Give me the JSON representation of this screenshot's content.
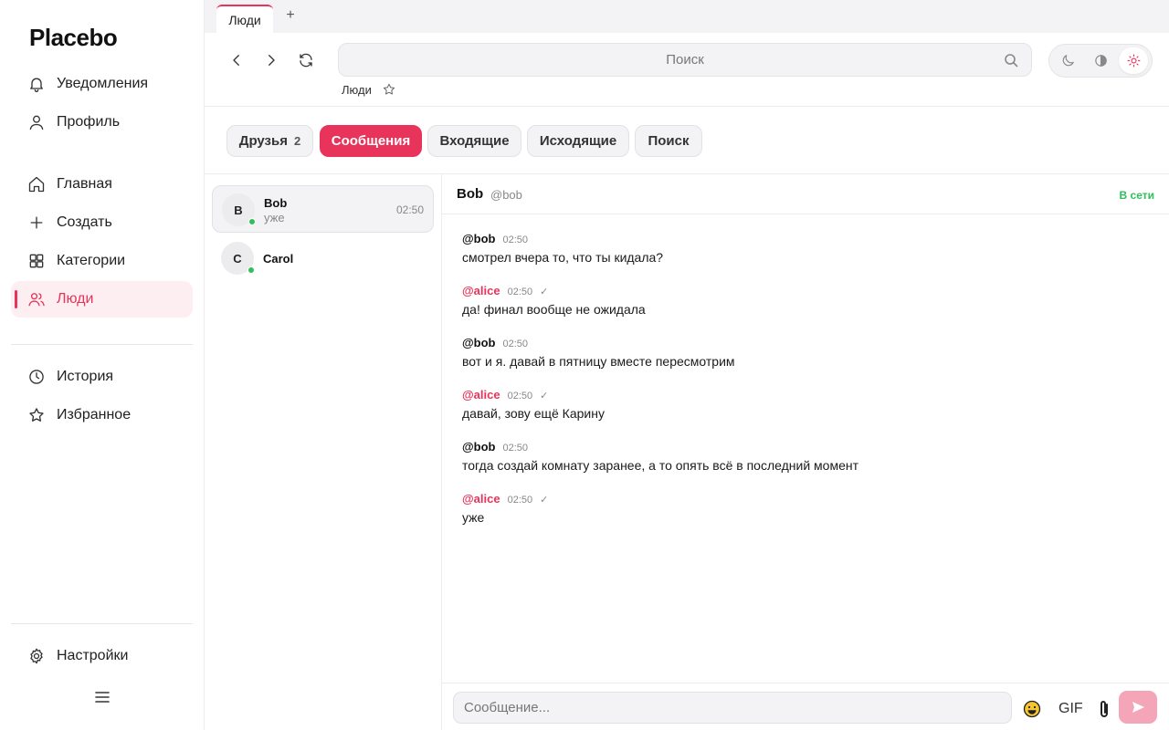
{
  "app": {
    "name": "Placebo"
  },
  "sidebar": {
    "items": [
      {
        "label": "Уведомления",
        "icon": "bell-icon"
      },
      {
        "label": "Профиль",
        "icon": "user-icon"
      },
      {
        "label": "Главная",
        "icon": "home-icon"
      },
      {
        "label": "Создать",
        "icon": "plus-icon"
      },
      {
        "label": "Категории",
        "icon": "grid-icon"
      },
      {
        "label": "Люди",
        "icon": "users-icon",
        "active": true
      },
      {
        "label": "История",
        "icon": "clock-icon"
      },
      {
        "label": "Избранное",
        "icon": "star-icon"
      }
    ],
    "settings_label": "Настройки",
    "menu_icon": "hamburger-icon"
  },
  "tabs": [
    {
      "label": "Люди",
      "active": true
    }
  ],
  "tab_add_label": "+",
  "toolbar": {
    "search_placeholder": "Поиск",
    "breadcrumb": "Люди",
    "theme_options": [
      "dark",
      "contrast",
      "light"
    ],
    "theme_selected": "light"
  },
  "filters": [
    {
      "label": "Друзья",
      "count": "2"
    },
    {
      "label": "Сообщения",
      "active": true
    },
    {
      "label": "Входящие"
    },
    {
      "label": "Исходящие"
    },
    {
      "label": "Поиск"
    }
  ],
  "conversations": [
    {
      "initial": "B",
      "name": "Bob",
      "preview": "уже",
      "time": "02:50",
      "online": true,
      "active": true
    },
    {
      "initial": "C",
      "name": "Carol",
      "preview": "",
      "time": "",
      "online": true,
      "active": false
    }
  ],
  "chat": {
    "name": "Bob",
    "handle": "@bob",
    "status": "В сети",
    "messages": [
      {
        "author": "@bob",
        "time": "02:50",
        "text": "смотрел вчера то, что ты кидала?",
        "mine": false
      },
      {
        "author": "@alice",
        "time": "02:50",
        "check": "✓",
        "text": "да! финал вообще не ожидала",
        "mine": true
      },
      {
        "author": "@bob",
        "time": "02:50",
        "text": "вот и я. давай в пятницу вместе пересмотрим",
        "mine": false
      },
      {
        "author": "@alice",
        "time": "02:50",
        "check": "✓",
        "text": "давай, зову ещё Карину",
        "mine": true
      },
      {
        "author": "@bob",
        "time": "02:50",
        "text": "тогда создай комнату заранее, а то опять всё в последний момент",
        "mine": false
      },
      {
        "author": "@alice",
        "time": "02:50",
        "check": "✓",
        "text": "уже",
        "mine": true
      }
    ],
    "composer_placeholder": "Сообщение...",
    "gif_label": "GIF"
  },
  "colors": {
    "accent": "#e8345a",
    "online": "#2fbf5b",
    "send_disabled": "#f4a6b8"
  }
}
